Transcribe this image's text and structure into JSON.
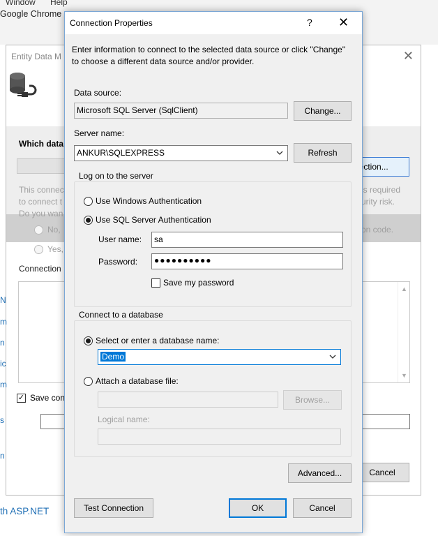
{
  "background": {
    "menu": [
      "Window",
      "Help"
    ],
    "taskbar_label": "Google Chrome",
    "wizard": {
      "title": "Entity Data M",
      "heading": "Which data",
      "new_connection_label": "nection...",
      "info_text_left": [
        "This connec",
        "to connect t",
        "Do you wan"
      ],
      "info_text_right": [
        "is required",
        "urity risk."
      ],
      "radio_no": "No,",
      "radio_yes": "Yes,",
      "code_text": "on code.",
      "connection_label": "Connection",
      "save_label": "Save con",
      "cancel_label": "Cancel",
      "left_strip": [
        "N",
        "m",
        "n",
        "ic",
        "m",
        "s",
        "n"
      ],
      "aspnet_link": "th ASP.NET"
    }
  },
  "dialog": {
    "title": "Connection Properties",
    "help": "?",
    "close": "✕",
    "intro": "Enter information to connect to the selected data source or click \"Change\" to choose a different data source and/or provider.",
    "data_source": {
      "label": "Data source:",
      "value": "Microsoft SQL Server (SqlClient)",
      "change_button": "Change..."
    },
    "server_name": {
      "label": "Server name:",
      "value": "ANKUR\\SQLEXPRESS",
      "refresh_button": "Refresh"
    },
    "logon": {
      "title": "Log on to the server",
      "windows_auth": "Use Windows Authentication",
      "sql_auth": "Use SQL Server Authentication",
      "selected": "sql",
      "user_name_label": "User name:",
      "user_name_value": "sa",
      "password_label": "Password:",
      "password_masked": "●●●●●●●●●●",
      "save_password_label": "Save my password",
      "save_password_checked": false
    },
    "database": {
      "title": "Connect to a database",
      "select_label": "Select or enter a database name:",
      "select_value": "Demo",
      "attach_label": "Attach a database file:",
      "attach_value": "",
      "browse_button": "Browse...",
      "logical_name_label": "Logical name:",
      "logical_name_value": "",
      "selected": "select"
    },
    "advanced_button": "Advanced...",
    "test_connection_button": "Test Connection",
    "ok_button": "OK",
    "cancel_button": "Cancel"
  }
}
